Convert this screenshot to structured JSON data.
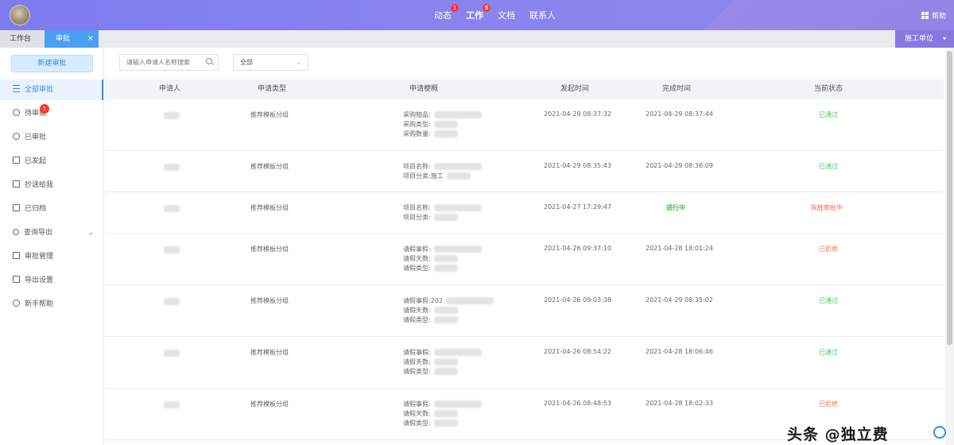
{
  "topbar": {
    "nav": [
      {
        "label": "动态",
        "badge": "1"
      },
      {
        "label": "工作",
        "badge": "5"
      },
      {
        "label": "文档",
        "badge": ""
      },
      {
        "label": "联系人",
        "badge": ""
      }
    ],
    "help_label": "帮助"
  },
  "tabs": {
    "workbench": "工作台",
    "approval": "审批",
    "close": "×",
    "unit_button": "施工单位",
    "unit_caret": "▾"
  },
  "sidebar": {
    "new_button": "新建审批",
    "items": [
      {
        "label": "全部审批",
        "icon": "list-icon"
      },
      {
        "label": "待审批",
        "icon": "clock-icon",
        "badge": "1"
      },
      {
        "label": "已审批",
        "icon": "check-circle-icon"
      },
      {
        "label": "已发起",
        "icon": "document-icon"
      },
      {
        "label": "抄送给我",
        "icon": "cc-icon"
      },
      {
        "label": "已归档",
        "icon": "folder-icon"
      },
      {
        "label": "查询导出",
        "icon": "search-icon"
      },
      {
        "label": "审批管理",
        "icon": "manage-icon"
      },
      {
        "label": "导出设置",
        "icon": "folder-settings-icon"
      },
      {
        "label": "新手帮助",
        "icon": "help-circle-icon"
      }
    ]
  },
  "filters": {
    "search_placeholder": "请输入申请人名称搜索",
    "select_value": "全部"
  },
  "table": {
    "headers": [
      "申请人",
      "申请类型",
      "申请梗概",
      "发起时间",
      "完成时间",
      "当前状态"
    ],
    "rows": [
      {
        "type": "推荐模板分组",
        "summary": [
          "采购物品:",
          "采购类型:",
          "采购数量:"
        ],
        "start": "2021-04-29 08:37:32",
        "end": "2021-04-29 08:37:44",
        "status": "已通过",
        "status_kind": "pass"
      },
      {
        "type": "推荐模板分组",
        "summary": [
          "项目名称:",
          "项目分类:施工"
        ],
        "start": "2021-04-29 08:35:43",
        "end": "2021-04-29 08:36:09",
        "status": "已通过",
        "status_kind": "pass"
      },
      {
        "type": "推荐模板分组",
        "summary": [
          "项目名称:",
          "项目分类:"
        ],
        "start": "2021-04-27 17:29:47",
        "end": "进行中",
        "status": "陈胜审批中",
        "status_kind": "pending"
      },
      {
        "type": "推荐模板分组",
        "summary": [
          "请假事假:",
          "请假天数:",
          "请假类型:"
        ],
        "start": "2021-04-26 09:37:10",
        "end": "2021-04-28 18:01:24",
        "status": "已拒绝",
        "status_kind": "reject"
      },
      {
        "type": "推荐模板分组",
        "summary": [
          "请假事假:202",
          "请假天数:",
          "请假类型:"
        ],
        "start": "2021-04-26 09:03:38",
        "end": "2021-04-29 08:35:02",
        "status": "已通过",
        "status_kind": "pass"
      },
      {
        "type": "推荐模板分组",
        "summary": [
          "请假事假:",
          "请假天数:",
          "请假类型:"
        ],
        "start": "2021-04-26 08:54:22",
        "end": "2021-04-28 18:06:46",
        "status": "已通过",
        "status_kind": "pass"
      },
      {
        "type": "推荐模板分组",
        "summary": [
          "请假事假:",
          "请假天数:",
          "请假类型:"
        ],
        "start": "2021-04-26 08:48:53",
        "end": "2021-04-28 18:02:33",
        "status": "已拒绝",
        "status_kind": "reject"
      }
    ]
  },
  "watermark": "头条 @独立费",
  "colors": {
    "accent": "#3a8ee6",
    "pass": "#49c96a",
    "reject": "#f07b4e",
    "topbar": "#8582ee"
  }
}
